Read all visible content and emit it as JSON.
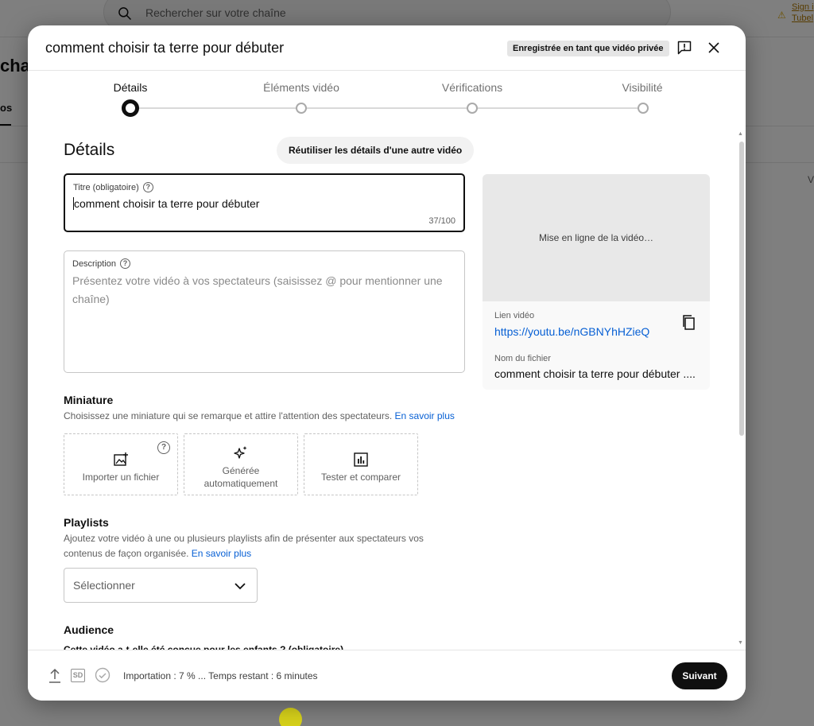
{
  "background": {
    "search_placeholder": "Rechercher sur votre chaîne",
    "signin_line1": "Sign i",
    "signin_line2": "Tubel",
    "left_chip": "cha",
    "left_tab": "os",
    "right_fragment": "V"
  },
  "modal": {
    "title": "comment choisir ta terre pour débuter",
    "saved_badge": "Enregistrée en tant que vidéo privée",
    "icons": {
      "feedback": "feedback-icon",
      "close": "close-icon"
    }
  },
  "stepper": {
    "steps": [
      {
        "label": "Détails",
        "active": true
      },
      {
        "label": "Éléments vidéo",
        "active": false
      },
      {
        "label": "Vérifications",
        "active": false
      },
      {
        "label": "Visibilité",
        "active": false
      }
    ]
  },
  "details": {
    "heading": "Détails",
    "reuse_button": "Réutiliser les détails d'une autre vidéo",
    "title_field": {
      "label": "Titre (obligatoire)",
      "value": "comment choisir ta terre pour débuter",
      "counter": "37/100"
    },
    "description_field": {
      "label": "Description",
      "placeholder": "Présentez votre vidéo à vos spectateurs (saisissez @ pour mentionner une chaîne)"
    }
  },
  "preview": {
    "thumb_status": "Mise en ligne de la vidéo…",
    "link_label": "Lien vidéo",
    "link_value": "https://youtu.be/nGBNYhHZieQ",
    "file_label": "Nom du fichier",
    "file_value": "comment choisir ta terre pour débuter ...."
  },
  "thumbnail": {
    "heading": "Miniature",
    "description": "Choisissez une miniature qui se remarque et attire l'attention des spectateurs.",
    "learn_more": "En savoir plus",
    "options": [
      {
        "label": "Importer un fichier",
        "icon": "image-upload-icon"
      },
      {
        "label": "Générée automatiquement",
        "icon": "sparkle-icon"
      },
      {
        "label": "Tester et comparer",
        "icon": "bar-chart-icon"
      }
    ]
  },
  "playlists": {
    "heading": "Playlists",
    "description": "Ajoutez votre vidéo à une ou plusieurs playlists afin de présenter aux spectateurs vos contenus de façon organisée.",
    "learn_more": "En savoir plus",
    "select_value": "Sélectionner"
  },
  "audience": {
    "heading": "Audience",
    "question_cut": "Cette vidéo a-t-elle été conçue pour les enfants ? (obligatoire)"
  },
  "footer": {
    "status": "Importation : 7 % ... Temps restant : 6 minutes",
    "sd_badge": "SD",
    "next_button": "Suivant"
  }
}
